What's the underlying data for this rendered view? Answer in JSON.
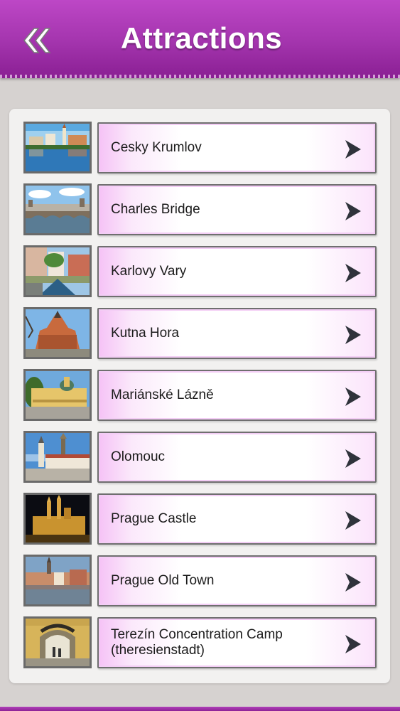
{
  "header": {
    "title": "Attractions",
    "back_icon": "double-chevron-left-icon",
    "color": "#a334ad"
  },
  "list": {
    "items": [
      {
        "label": "Cesky Krumlov",
        "thumb": "cesky-krumlov-photo"
      },
      {
        "label": "Charles Bridge",
        "thumb": "charles-bridge-photo"
      },
      {
        "label": "Karlovy Vary",
        "thumb": "karlovy-vary-photo"
      },
      {
        "label": "Kutna Hora",
        "thumb": "kutna-hora-photo"
      },
      {
        "label": "Mariánské Lázně",
        "thumb": "marianske-lazne-photo"
      },
      {
        "label": "Olomouc",
        "thumb": "olomouc-photo"
      },
      {
        "label": "Prague Castle",
        "thumb": "prague-castle-photo"
      },
      {
        "label": "Prague Old Town",
        "thumb": "prague-old-town-photo"
      },
      {
        "label": "Terezín Concentration Camp (theresienstadt)",
        "thumb": "terezin-photo"
      }
    ],
    "chevron_icon": "chevron-right-icon"
  }
}
